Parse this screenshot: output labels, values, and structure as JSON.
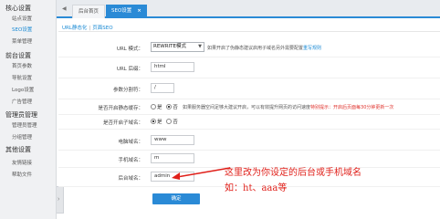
{
  "sidebar": {
    "groups": [
      {
        "title": "核心设置",
        "items": [
          "站点设置",
          "SEO设置",
          "菜单管理"
        ]
      },
      {
        "title": "前台设置",
        "items": [
          "首页参数",
          "导航设置",
          "Logo设置",
          "广告管理"
        ]
      },
      {
        "title": "管理员管理",
        "items": [
          "管理员管理",
          "分组管理"
        ]
      },
      {
        "title": "其他设置",
        "items": [
          "友情链接",
          "帮助文件"
        ]
      }
    ],
    "active_item": "SEO设置"
  },
  "tabs": {
    "home": "后台首页",
    "seo": "SEO设置",
    "close": "×"
  },
  "breadcrumb": {
    "first": "URL静态化",
    "sep": "|",
    "second": "页面SEO"
  },
  "form": {
    "url_mode": {
      "label": "URL 模式：",
      "value": "REWRITE模式",
      "hint_prefix": "如果开启了伪静态建议启用子域名另外需要配置",
      "hint_link": "重写规则"
    },
    "url_suffix": {
      "label": "URL 后缀：",
      "value": "html"
    },
    "param_sep": {
      "label": "参数分割符：",
      "value": "/"
    },
    "static_cache": {
      "label": "是否开启静态缓存：",
      "opt_yes": "是",
      "opt_no": "否",
      "selected": "否",
      "hint_prefix": "如果服务器空间足够大建议开启，可以有效提升网页的访问速度",
      "hint_red": "特别提示：开启后页面每30分钟更新一次"
    },
    "subdomain": {
      "label": "是否开启子域名：",
      "opt_yes": "是",
      "opt_no": "否",
      "selected": "是"
    },
    "pc_domain": {
      "label": "电脑域名：",
      "value": "www"
    },
    "mobile_domain": {
      "label": "手机域名：",
      "value": "m"
    },
    "admin_domain": {
      "label": "后台域名：",
      "value": "admin"
    },
    "confirm": "确定"
  },
  "annotation": {
    "line1": "这里改为你设定的后台或手机域名",
    "line2": "如：ht、aaa等",
    "color": "#e0201a"
  },
  "colors": {
    "accent": "#2a8ad6",
    "link": "#1a8ad4",
    "warning": "#e0332d"
  }
}
